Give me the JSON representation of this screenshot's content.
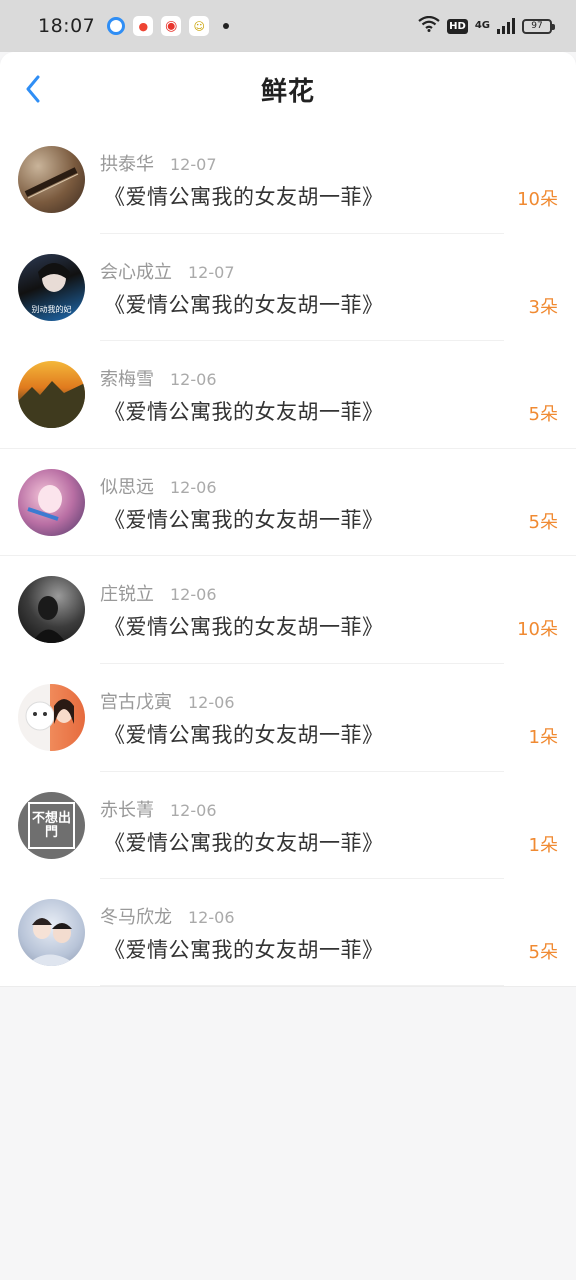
{
  "status_bar": {
    "time": "18:07",
    "battery": "97",
    "network": "4G",
    "hd": "HD",
    "app_icons": [
      "browser-icon",
      "map-icon",
      "weibo-icon",
      "baby-app-icon"
    ]
  },
  "header": {
    "title": "鲜花",
    "back_icon": "chevron-left-icon",
    "accent": "#2f8ef5"
  },
  "colors": {
    "count": "#f08a32",
    "name": "#999999",
    "title": "#333333"
  },
  "list": [
    {
      "name": "拱泰华",
      "date": "12-07",
      "title": "《爱情公寓我的女友胡一菲》",
      "count": "10朵"
    },
    {
      "name": "会心成立",
      "date": "12-07",
      "title": "《爱情公寓我的女友胡一菲》",
      "count": "3朵",
      "avatar_caption": "别动我的妃"
    },
    {
      "name": "索梅雪",
      "date": "12-06",
      "title": "《爱情公寓我的女友胡一菲》",
      "count": "5朵"
    },
    {
      "name": "似思远",
      "date": "12-06",
      "title": "《爱情公寓我的女友胡一菲》",
      "count": "5朵"
    },
    {
      "name": "庄锐立",
      "date": "12-06",
      "title": "《爱情公寓我的女友胡一菲》",
      "count": "10朵"
    },
    {
      "name": "宫古戊寅",
      "date": "12-06",
      "title": "《爱情公寓我的女友胡一菲》",
      "count": "1朵"
    },
    {
      "name": "赤长菁",
      "date": "12-06",
      "title": "《爱情公寓我的女友胡一菲》",
      "count": "1朵",
      "avatar_caption": "不想出門"
    },
    {
      "name": "冬马欣龙",
      "date": "12-06",
      "title": "《爱情公寓我的女友胡一菲》",
      "count": "5朵"
    }
  ]
}
